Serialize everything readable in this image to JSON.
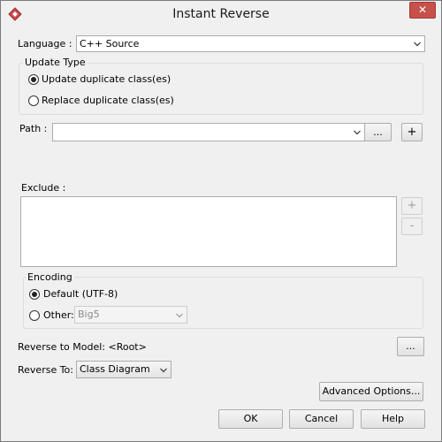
{
  "window": {
    "title": "Instant Reverse"
  },
  "language": {
    "label": "Language :",
    "value": "C++ Source"
  },
  "update_type": {
    "title": "Update Type",
    "options": [
      "Update duplicate class(es)",
      "Replace duplicate class(es)"
    ],
    "selected": 0
  },
  "path": {
    "label": "Path :",
    "value": "",
    "browse_label": "...",
    "add_label": "+"
  },
  "exclude": {
    "label": "Exclude :",
    "add_label": "+",
    "remove_label": "-"
  },
  "encoding": {
    "title": "Encoding",
    "default_label": "Default (UTF-8)",
    "other_label": "Other:",
    "other_value": "Big5",
    "selected": "default"
  },
  "reverse_model": {
    "label": "Reverse to Model:",
    "value": "<Root>",
    "browse_label": "..."
  },
  "reverse_to": {
    "label": "Reverse To:",
    "value": "Class Diagram"
  },
  "buttons": {
    "advanced": "Advanced Options...",
    "ok": "OK",
    "cancel": "Cancel",
    "help": "Help"
  },
  "colors": {
    "accent": "#c7504a",
    "app_icon": "#d0474a"
  },
  "icons": {
    "app": "diamond-app-icon",
    "close": "close-icon",
    "dropdown": "chevron-down-icon"
  }
}
